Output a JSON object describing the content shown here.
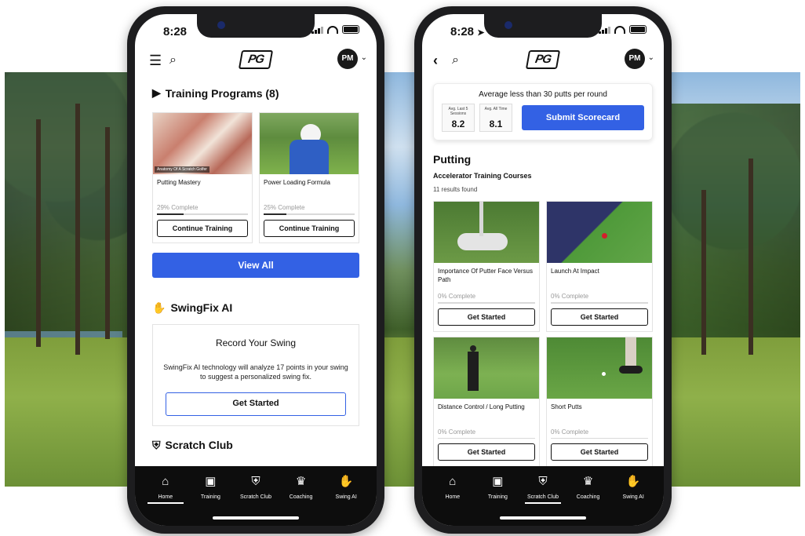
{
  "colors": {
    "accent": "#3361e4",
    "tabbar": "#0d0d0d"
  },
  "phone1": {
    "time": "8:28",
    "avatar": "PM",
    "logo": "PG",
    "training": {
      "heading": "Training Programs (8)",
      "cards": [
        {
          "image_caption": "Anatomy Of A Scratch Golfer",
          "title": "Putting Mastery",
          "progress_text": "29% Complete",
          "progress": 0.29,
          "button": "Continue Training"
        },
        {
          "title": "Power Loading Formula",
          "progress_text": "25% Complete",
          "progress": 0.25,
          "button": "Continue Training"
        }
      ],
      "view_all": "View All"
    },
    "swingfix": {
      "heading": "SwingFix AI",
      "box_title": "Record Your Swing",
      "box_text": "SwingFix AI technology will analyze 17 points in your swing to suggest a personalized swing fix.",
      "button": "Get Started"
    },
    "scratch": {
      "heading": "Scratch Club"
    }
  },
  "phone2": {
    "time": "8:28",
    "avatar": "PM",
    "logo": "PG",
    "scorecard": {
      "headline": "Average less than 30 putts per round",
      "stat1_label": "Avg. Last 5 Sessions",
      "stat1_value": "8.2",
      "stat2_label": "Avg. All Time",
      "stat2_value": "8.1",
      "button": "Submit Scorecard"
    },
    "putting": {
      "title": "Putting",
      "subtitle": "Accelerator Training Courses",
      "results": "11 results found",
      "courses": [
        {
          "title": "Importance Of Putter Face Versus Path",
          "progress_text": "0% Complete",
          "progress": 0,
          "button": "Get Started"
        },
        {
          "title": "Launch At Impact",
          "progress_text": "0% Complete",
          "progress": 0,
          "button": "Get Started"
        },
        {
          "title": "Distance Control / Long Putting",
          "progress_text": "0% Complete",
          "progress": 0,
          "button": "Get Started"
        },
        {
          "title": "Short Putts",
          "progress_text": "0% Complete",
          "progress": 0,
          "button": "Get Started"
        }
      ]
    }
  },
  "tabs": [
    {
      "label": "Home",
      "icon": "home-icon"
    },
    {
      "label": "Training",
      "icon": "play-icon"
    },
    {
      "label": "Scratch Club",
      "icon": "shield-crest-icon"
    },
    {
      "label": "Coaching",
      "icon": "crown-icon"
    },
    {
      "label": "Swing AI",
      "icon": "swing-hand-icon"
    }
  ],
  "phone1_active_tab": "Home",
  "phone2_active_tab": "Scratch Club"
}
